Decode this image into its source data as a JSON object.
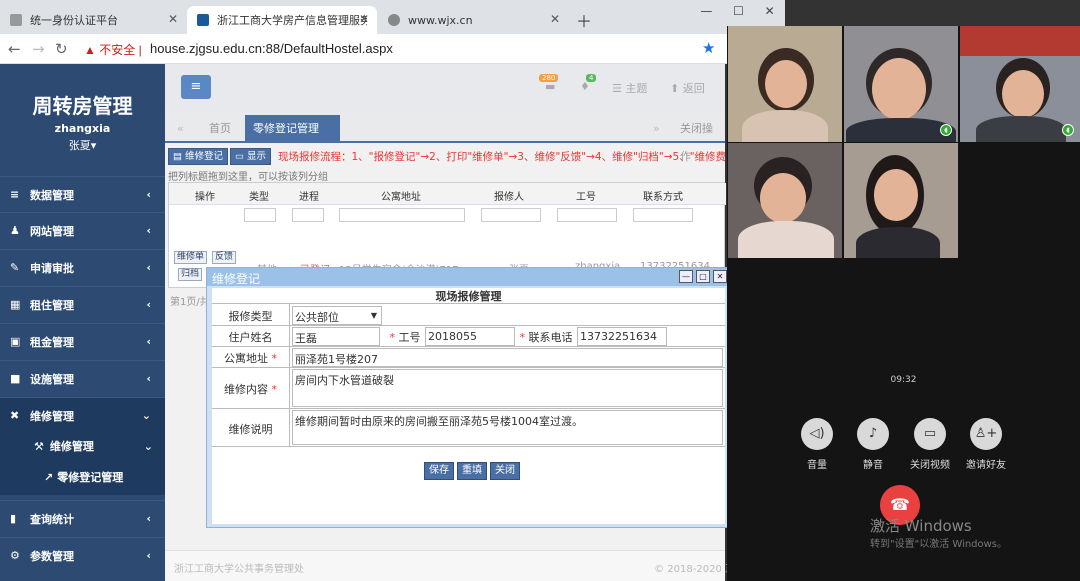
{
  "browser": {
    "tabs": [
      {
        "title": "统一身份认证平台"
      },
      {
        "title": "浙江工商大学房产信息管理服务"
      },
      {
        "title": "www.wjx.cn"
      }
    ],
    "security_warning": "不安全",
    "url": "house.zjgsu.edu.cn:88/DefaultHostel.aspx"
  },
  "sidebar": {
    "brand": "周转房管理",
    "username": "zhangxia",
    "display_name": "张夏▾",
    "menus": [
      {
        "label": "数据管理"
      },
      {
        "label": "网站管理"
      },
      {
        "label": "申请审批"
      },
      {
        "label": "租住管理"
      },
      {
        "label": "租金管理"
      },
      {
        "label": "设施管理"
      },
      {
        "label": "维修管理"
      },
      {
        "label": "查询统计"
      },
      {
        "label": "参数管理"
      }
    ],
    "sub": {
      "label": "维修管理",
      "item": "零修登记管理"
    }
  },
  "topbar": {
    "badge1": "280",
    "badge2": "4",
    "theme": "主题",
    "back": "返回"
  },
  "page_tabs": {
    "home": "首页",
    "current": "零修登记管理",
    "close_ops": "关闭操作"
  },
  "toolbar": {
    "register": "维修登记",
    "show": "显示",
    "flow": "现场报修流程：1、\"报修登记\"→2、打印\"维修单\"→3、维修\"反馈\"→4、维修\"归档\"→5、\"维修费用核"
  },
  "grid": {
    "hint": "把列标题拖到这里，可以按该列分组",
    "headers": [
      "操作",
      "类型",
      "进程",
      "公寓地址",
      "报修人",
      "工号",
      "联系方式"
    ],
    "row": {
      "actions": [
        "维修单",
        "反馈",
        "归档",
        "删除"
      ],
      "type": "其他",
      "status": "已登记",
      "address": "12号学生宿舍(金沙港)717",
      "reporter": "张夏",
      "emp_id": "zhangxia",
      "phone": "13732251634"
    },
    "pager": "第1页/共"
  },
  "dialog": {
    "title": "维修登记",
    "form_title": "现场报修管理",
    "labels": {
      "type": "报修类型",
      "name": "住户姓名",
      "emp_id": "工号",
      "phone": "联系电话",
      "address": "公寓地址",
      "content": "维修内容",
      "note": "维修说明"
    },
    "values": {
      "type": "公共部位",
      "name": "王磊",
      "emp_id": "2018055",
      "phone": "13732251634",
      "address": "丽泽苑1号楼207",
      "content": "房间内下水管道破裂",
      "note": "维修期间暂时由原来的房间搬至丽泽苑5号楼1004室过渡。"
    },
    "buttons": {
      "save": "保存",
      "reset": "重填",
      "close": "关闭"
    }
  },
  "footer": {
    "left": "浙江工商大学公共事务管理处",
    "right": "© 2018-2020 正导科技"
  },
  "call": {
    "time": "09:32",
    "controls": [
      "音量",
      "静音",
      "关闭视频",
      "邀请好友"
    ],
    "activation_title": "激活 Windows",
    "activation_sub": "转到\"设置\"以激活 Windows。"
  }
}
